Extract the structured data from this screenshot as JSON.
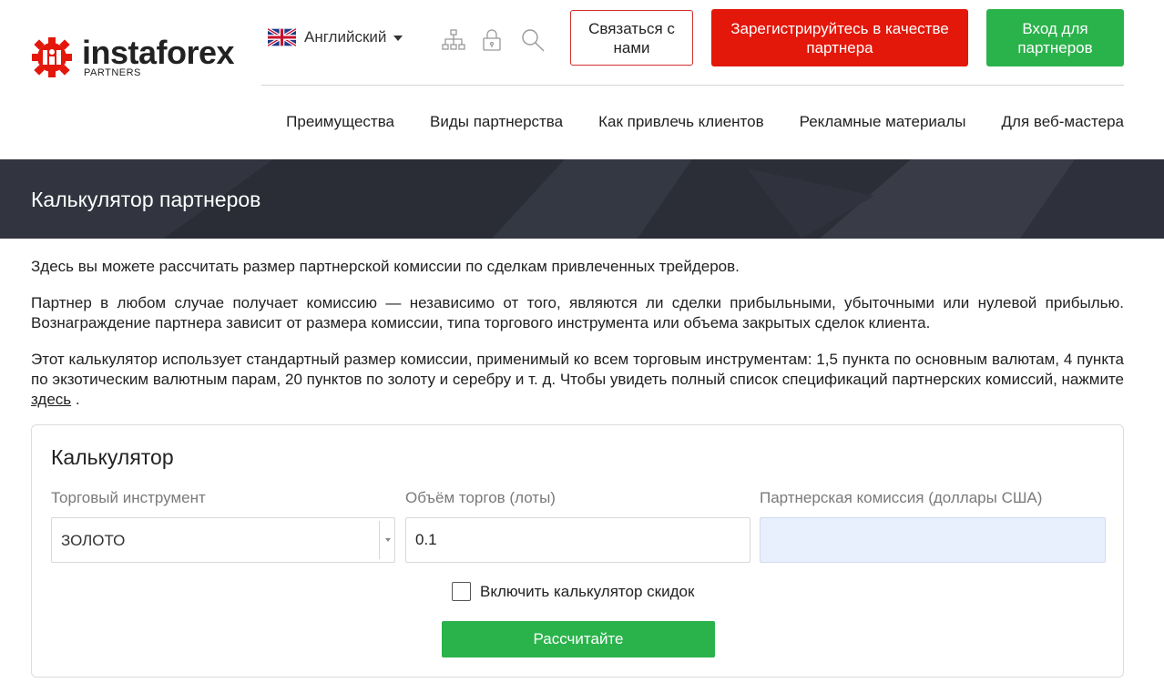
{
  "brand": {
    "name": "instaforex",
    "sub": "PARTNERS",
    "logo_color": "#e3170a"
  },
  "header": {
    "language": "Английский",
    "icons": [
      "sitemap-icon",
      "lock-icon",
      "search-icon"
    ],
    "contact_button": "Связаться с нами",
    "register_button": "Зарегистрируйтесь в качестве партнера",
    "login_button": "Вход для партнеров",
    "nav": [
      "Преимущества",
      "Виды партнерства",
      "Как привлечь клиентов",
      "Рекламные материалы",
      "Для веб-мастера"
    ]
  },
  "banner": {
    "title": "Калькулятор партнеров"
  },
  "content": {
    "p1": "Здесь вы можете рассчитать размер партнерской комиссии по сделкам привлеченных трейдеров.",
    "p2": "Партнер в любом случае получает комиссию — независимо от того, являются ли сделки прибыльными, убыточными или нулевой прибылью. Вознаграждение партнера зависит от размера комиссии, типа торгового инструмента или объема закрытых сделок клиента.",
    "p3_before": "Этот калькулятор использует стандартный размер комиссии, применимый ко всем торговым инструментам: 1,5 пункта по основным валютам, 4 пункта по экзотическим валютным парам, 20 пунктов по золоту и серебру и т. д. Чтобы увидеть полный список спецификаций партнерских комиссий, нажмите ",
    "p3_link": "здесь",
    "p3_after": " ."
  },
  "calculator": {
    "title": "Калькулятор",
    "instrument_label": "Торговый инструмент",
    "instrument_value": "ЗОЛОТО",
    "volume_label": "Объём торгов (лоты)",
    "volume_value": "0.1",
    "commission_label": "Партнерская комиссия (доллары США)",
    "commission_value": "",
    "discount_label": "Включить калькулятор скидок",
    "discount_checked": false,
    "submit_label": "Рассчитайте"
  },
  "colors": {
    "accent_red": "#e3170a",
    "accent_green": "#2ab34b",
    "banner_bg": "#2d3039",
    "output_bg": "#e8f0fe"
  }
}
